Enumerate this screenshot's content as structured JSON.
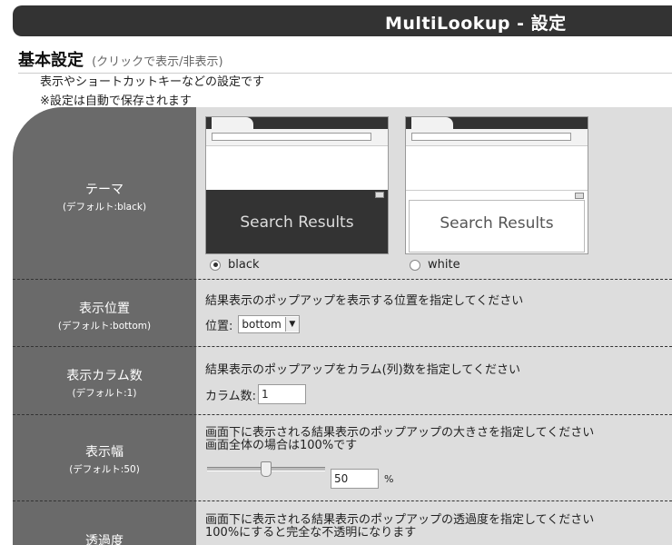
{
  "app": {
    "title": "MultiLookup - 設定"
  },
  "section": {
    "title": "基本設定",
    "toggle": "(クリックで表示/非表示)",
    "desc1": "表示やショートカットキーなどの設定です",
    "desc2": "※設定は自動で保存されます"
  },
  "theme": {
    "label": "テーマ",
    "default": "(デフォルト:black)",
    "options": [
      {
        "value": "black",
        "preview_text": "Search Results",
        "checked": true
      },
      {
        "value": "white",
        "preview_text": "Search Results",
        "checked": false
      }
    ]
  },
  "position": {
    "label": "表示位置",
    "default": "(デフォルト:bottom)",
    "description": "結果表示のポップアップを表示する位置を指定してください",
    "field_label": "位置:",
    "value": "bottom"
  },
  "columns": {
    "label": "表示カラム数",
    "default": "(デフォルト:1)",
    "description": "結果表示のポップアップをカラム(列)数を指定してください",
    "field_label": "カラム数:",
    "value": "1"
  },
  "width": {
    "label": "表示幅",
    "default": "(デフォルト:50)",
    "description1": "画面下に表示される結果表示のポップアップの大きさを指定してください",
    "description2": "画面全体の場合は100%です",
    "value": "50",
    "unit": "%",
    "slider_fraction": 0.5
  },
  "opacity": {
    "label": "透過度",
    "description1": "画面下に表示される結果表示のポップアップの透過度を指定してください",
    "description2": "100%にすると完全な不透明になります"
  },
  "colors": {
    "title_bg": "#333333",
    "label_col": "#6a6a6a",
    "content_bg": "#dddddd"
  }
}
